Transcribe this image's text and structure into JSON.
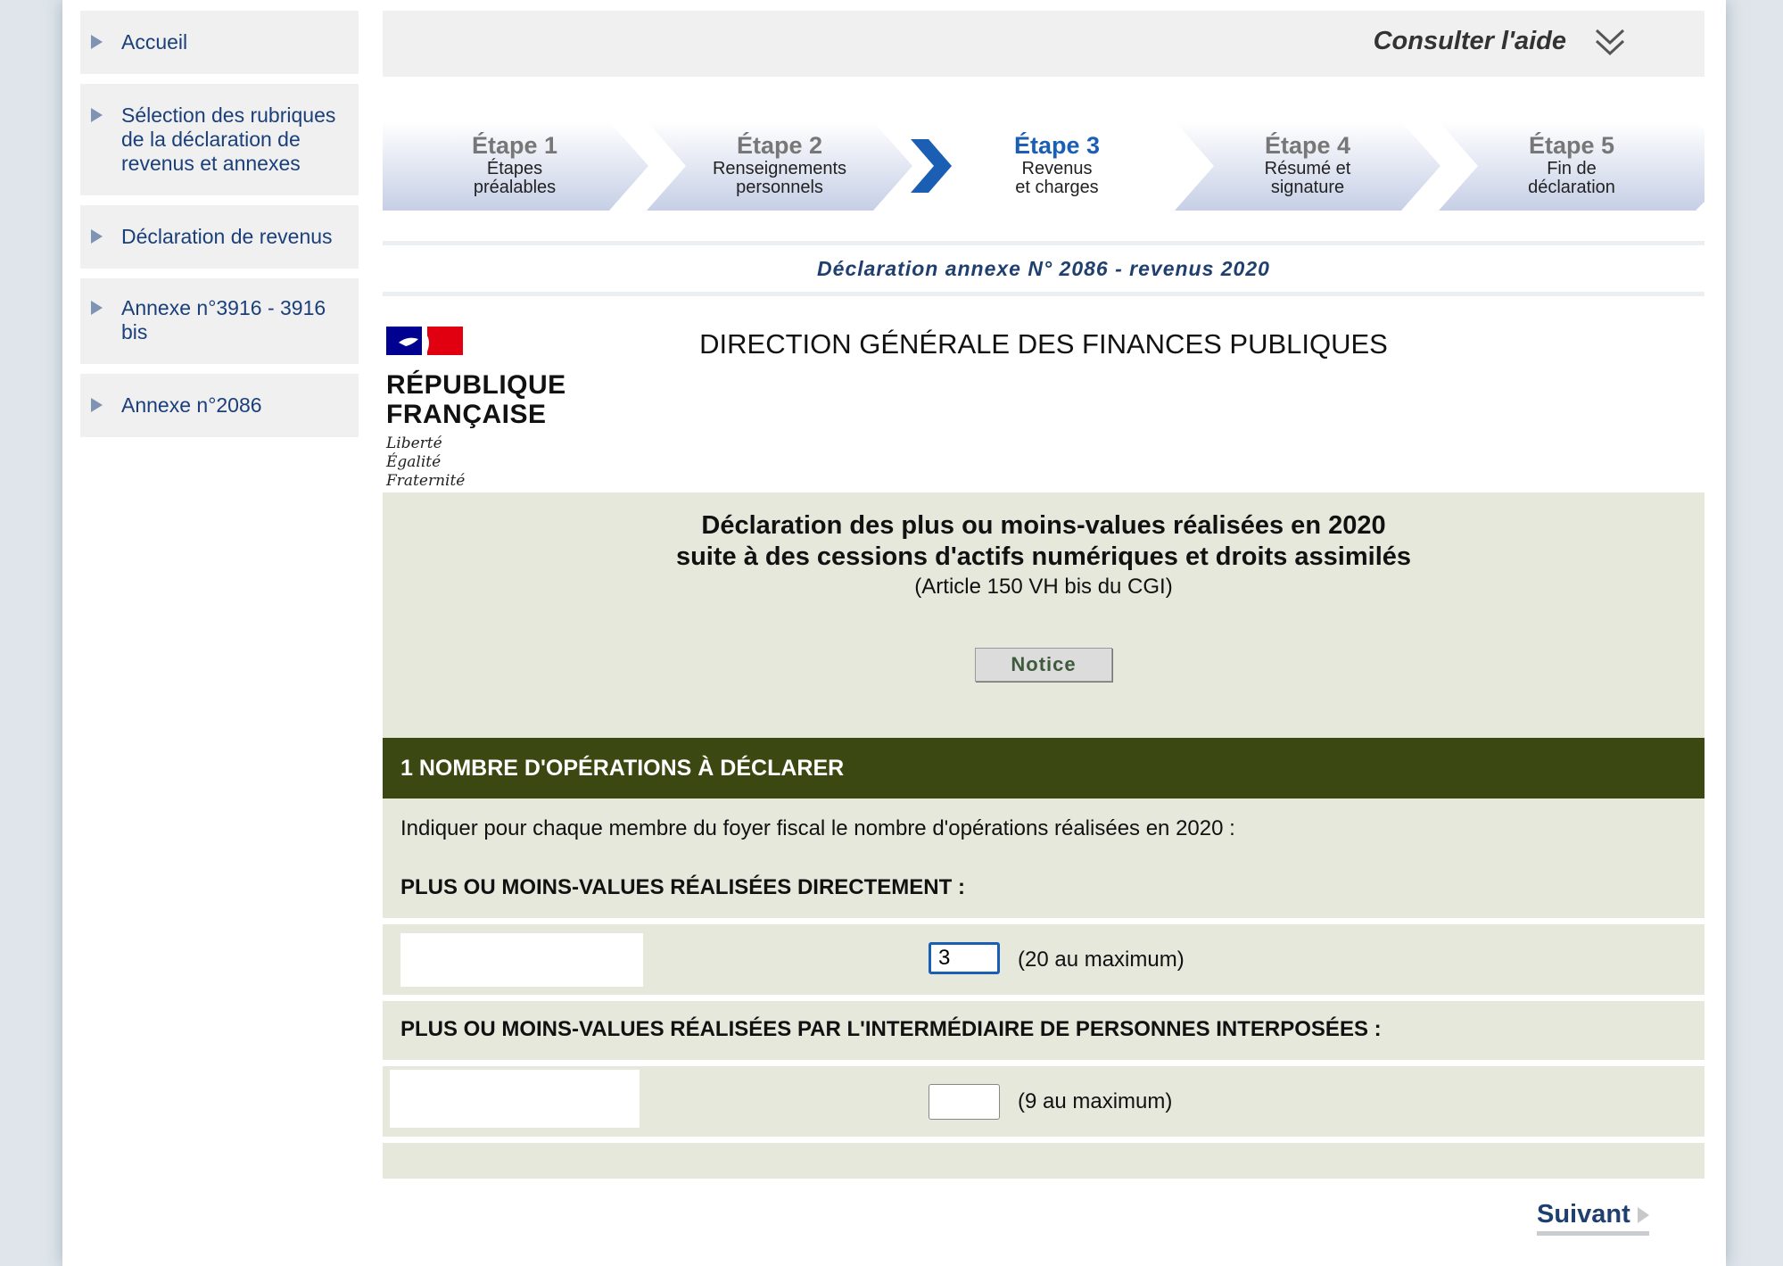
{
  "sidebar": {
    "items": [
      {
        "label": "Accueil"
      },
      {
        "label": "Sélection des rubriques de la déclaration de revenus et annexes"
      },
      {
        "label": "Déclaration de revenus"
      },
      {
        "label": "Annexe n°3916 - 3916 bis"
      },
      {
        "label": "Annexe n°2086"
      }
    ]
  },
  "header": {
    "help_label": "Consulter l'aide",
    "help_icon": "double-chevron-down-icon"
  },
  "steps": [
    {
      "number": "Étape 1",
      "line1": "Étapes",
      "line2": "préalables",
      "current": false
    },
    {
      "number": "Étape 2",
      "line1": "Renseignements",
      "line2": "personnels",
      "current": false
    },
    {
      "number": "Étape 3",
      "line1": "Revenus",
      "line2": "et charges",
      "current": true
    },
    {
      "number": "Étape 4",
      "line1": "Résumé et",
      "line2": "signature",
      "current": false
    },
    {
      "number": "Étape 5",
      "line1": "Fin de",
      "line2": "déclaration",
      "current": false
    }
  ],
  "annex_title": "Déclaration annexe N° 2086 - revenus 2020",
  "logo": {
    "line1": "RÉPUBLIQUE",
    "line2": "FRANÇAISE",
    "motto1": "Liberté",
    "motto2": "Égalité",
    "motto3": "Fraternité"
  },
  "dgfip": "DIRECTION GÉNÉRALE DES FINANCES PUBLIQUES",
  "form": {
    "title_line1": "Déclaration des plus ou moins-values réalisées en 2020",
    "title_line2": "suite à des cessions d'actifs numériques et droits assimilés",
    "article": "(Article 150 VH bis du CGI)",
    "notice_label": "Notice"
  },
  "section1": {
    "title": "1 NOMBRE D'OPÉRATIONS À DÉCLARER",
    "instruction": "Indiquer pour chaque membre du foyer fiscal le nombre d'opérations réalisées en 2020 :",
    "direct_heading": "PLUS OU MOINS-VALUES RÉALISÉES DIRECTEMENT :",
    "direct_value": "3",
    "direct_max": "(20 au maximum)",
    "interposed_heading": "PLUS OU MOINS-VALUES RÉALISÉES PAR L'INTERMÉDIAIRE DE PERSONNES INTERPOSÉES :",
    "interposed_value": "",
    "interposed_max": "(9 au maximum)"
  },
  "next_label": "Suivant",
  "colors": {
    "accent": "#1a5fb4",
    "section": "#3c4811",
    "panel": "#e6e8dc",
    "link": "#1a3f7a"
  }
}
